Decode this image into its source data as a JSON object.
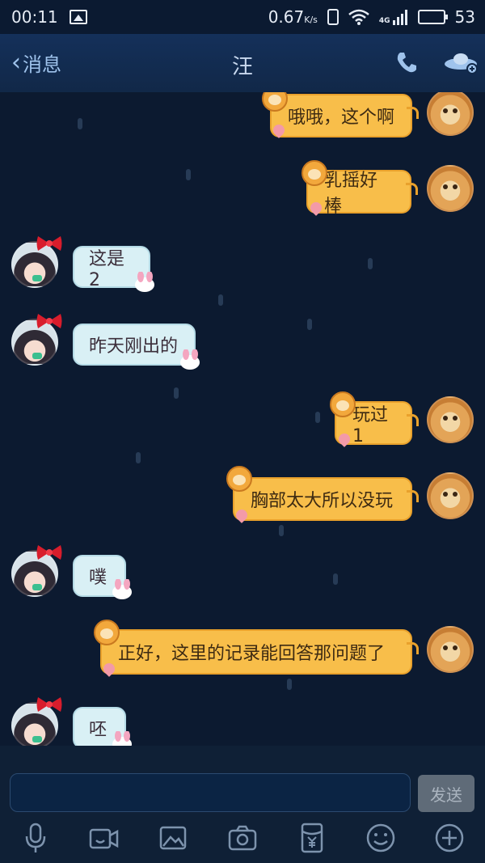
{
  "status_bar": {
    "time": "00:11",
    "speed_value": "0.67",
    "speed_unit": "K/s",
    "network": "4G",
    "battery": "53",
    "battery_fraction": 0.53
  },
  "header": {
    "back_label": "消息",
    "title": "汪"
  },
  "messages": [
    {
      "side": "right",
      "text": "哦哦，这个啊"
    },
    {
      "side": "right",
      "text": "乳摇好棒"
    },
    {
      "side": "left",
      "text": "这是2"
    },
    {
      "side": "left",
      "text": "昨天刚出的"
    },
    {
      "side": "right",
      "text": "玩过1"
    },
    {
      "side": "right",
      "text": "胸部太大所以没玩"
    },
    {
      "side": "left",
      "text": "噗"
    },
    {
      "side": "right",
      "text": "正好，这里的记录能回答那问题了"
    },
    {
      "side": "left",
      "text": "呸"
    }
  ],
  "input": {
    "placeholder": "",
    "send_label": "发送"
  },
  "colors": {
    "accent": "#9fc3ec",
    "bubble_right": "#f8be4a",
    "bubble_left": "#d9f0f5",
    "background": "#0c1a30"
  },
  "toolbar_icons": [
    "microphone-icon",
    "video-call-icon",
    "image-icon",
    "camera-icon",
    "red-envelope-icon",
    "emoji-icon",
    "plus-icon"
  ]
}
